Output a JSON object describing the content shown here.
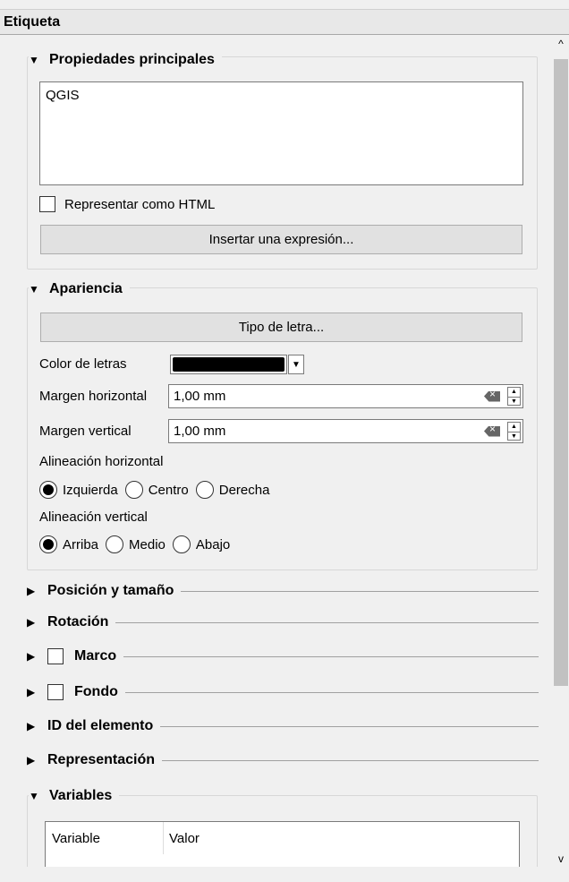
{
  "panel": {
    "title": "Etiqueta"
  },
  "main_properties": {
    "title": "Propiedades principales",
    "text_value": "QGIS",
    "render_html_label": "Representar como HTML",
    "render_html_checked": false,
    "insert_expression_label": "Insertar una expresión..."
  },
  "appearance": {
    "title": "Apariencia",
    "font_button_label": "Tipo de letra...",
    "font_color_label": "Color de letras",
    "font_color": "#000000",
    "margin_h_label": "Margen horizontal",
    "margin_h_value": "1,00 mm",
    "margin_v_label": "Margen vertical",
    "margin_v_value": "1,00 mm",
    "halign_label": "Alineación horizontal",
    "halign_options": [
      "Izquierda",
      "Centro",
      "Derecha"
    ],
    "halign_selected": "Izquierda",
    "valign_label": "Alineación vertical",
    "valign_options": [
      "Arriba",
      "Medio",
      "Abajo"
    ],
    "valign_selected": "Arriba"
  },
  "collapsed_sections": {
    "position_size": "Posición y tamaño",
    "rotation": "Rotación",
    "frame": "Marco",
    "background": "Fondo",
    "item_id": "ID del elemento",
    "rendering": "Representación"
  },
  "variables": {
    "title": "Variables",
    "columns": [
      "Variable",
      "Valor"
    ]
  },
  "icons": {
    "expanded": "▼",
    "collapsed": "▶",
    "scroll_up": "^",
    "scroll_down": "v"
  }
}
